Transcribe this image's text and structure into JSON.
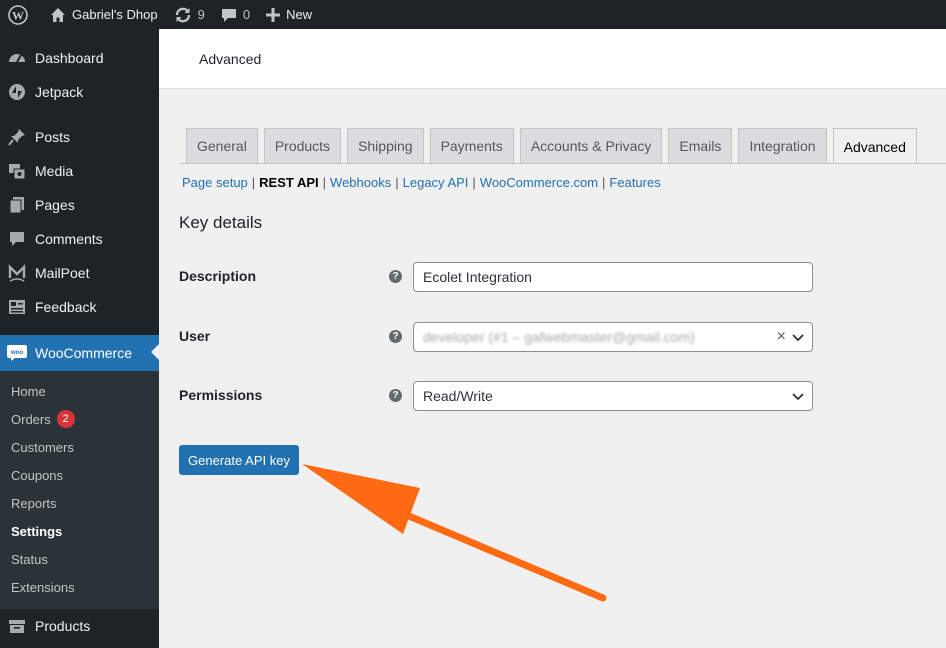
{
  "adminbar": {
    "site_name": "Gabriel's Dhop",
    "updates_count": "9",
    "comments_count": "0",
    "new_label": "New"
  },
  "sidebar": {
    "items": [
      {
        "label": "Dashboard",
        "icon": "dashboard-icon"
      },
      {
        "label": "Jetpack",
        "icon": "jetpack-icon"
      },
      {
        "label": "Posts",
        "icon": "pin-icon"
      },
      {
        "label": "Media",
        "icon": "media-icon"
      },
      {
        "label": "Pages",
        "icon": "pages-icon"
      },
      {
        "label": "Comments",
        "icon": "comments-icon"
      },
      {
        "label": "MailPoet",
        "icon": "mailpoet-icon"
      },
      {
        "label": "Feedback",
        "icon": "feedback-icon"
      }
    ],
    "woocommerce": {
      "label": "WooCommerce",
      "icon_text": "woo"
    },
    "submenu": [
      "Home",
      "Orders",
      "Customers",
      "Coupons",
      "Reports",
      "Settings",
      "Status",
      "Extensions"
    ],
    "orders_badge": "2",
    "products_label": "Products"
  },
  "header": {
    "title": "Advanced"
  },
  "tabs": [
    "General",
    "Products",
    "Shipping",
    "Payments",
    "Accounts & Privacy",
    "Emails",
    "Integration",
    "Advanced"
  ],
  "subnav": {
    "page_setup": "Page setup",
    "rest_api": "REST API",
    "webhooks": "Webhooks",
    "legacy_api": "Legacy API",
    "woocommerce_com": "WooCommerce.com",
    "features": "Features",
    "sep": "|"
  },
  "form": {
    "section_title": "Key details",
    "description_label": "Description",
    "description_value": "Ecolet Integration",
    "user_label": "User",
    "user_value": "developer (#1 – gafwebmaster@gmail.com)",
    "permissions_label": "Permissions",
    "permissions_value": "Read/Write",
    "help": "?",
    "clear": "×"
  },
  "generate_button": "Generate API key",
  "colors": {
    "primary": "#2271b1",
    "admin_dark": "#1d2327",
    "annotation_arrow": "#ff6a13"
  }
}
